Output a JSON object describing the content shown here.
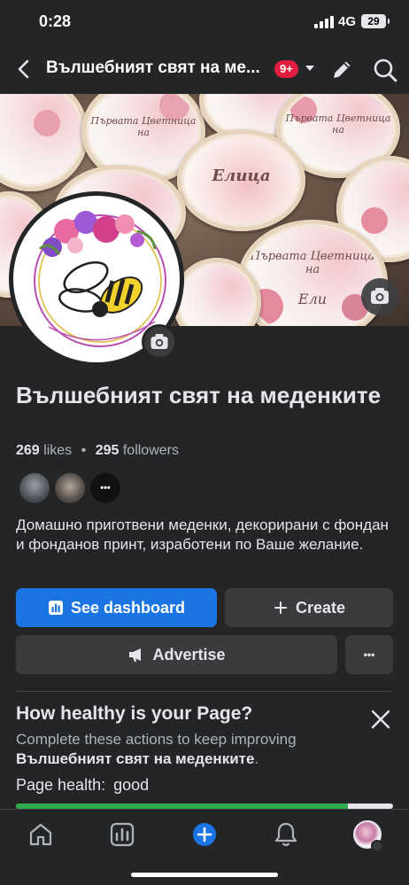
{
  "status_bar": {
    "time": "0:28",
    "network": "4G",
    "battery": "29"
  },
  "header": {
    "title": "Вълшебният свят на ме...",
    "notifications_badge": "9+"
  },
  "cover": {
    "cookie_names": [
      "Елица",
      "Ели"
    ],
    "cookie_captions": [
      "Първата Цветница на",
      "Първата Цветница на",
      "Първата Цветница на"
    ]
  },
  "avatar": {
    "logo_text": "Вълшебният свят на меденките"
  },
  "page": {
    "name": "Вълшебният свят на меденките",
    "likes_count": "269",
    "likes_label": "likes",
    "followers_count": "295",
    "followers_label": "followers",
    "separator": "•",
    "more_friends": "•••",
    "bio": "Домашно приготвени меденки, декорирани с фондан и фонданов принт, изработени по Ваше желание."
  },
  "actions": {
    "dashboard_label": "See dashboard",
    "create_label": "Create",
    "advertise_label": "Advertise",
    "more_label": "•••"
  },
  "health": {
    "title": "How healthy is your Page?",
    "desc_prefix": "Complete these actions to keep improving",
    "desc_page": "Вълшебният свят на меденките",
    "desc_suffix": ".",
    "status_label": "Page health:",
    "status_value": "good",
    "progress": 0.88
  },
  "colors": {
    "accent": "#1b74e4",
    "badge": "#e41e3f",
    "health_good": "#2fa84f",
    "background": "#242526"
  },
  "icons": [
    "back-icon",
    "caret-down-icon",
    "edit-icon",
    "search-icon",
    "camera-icon",
    "dashboard-icon",
    "plus-icon",
    "megaphone-icon",
    "close-icon",
    "home-icon",
    "insights-icon",
    "add-icon",
    "bell-icon",
    "profile-icon"
  ]
}
